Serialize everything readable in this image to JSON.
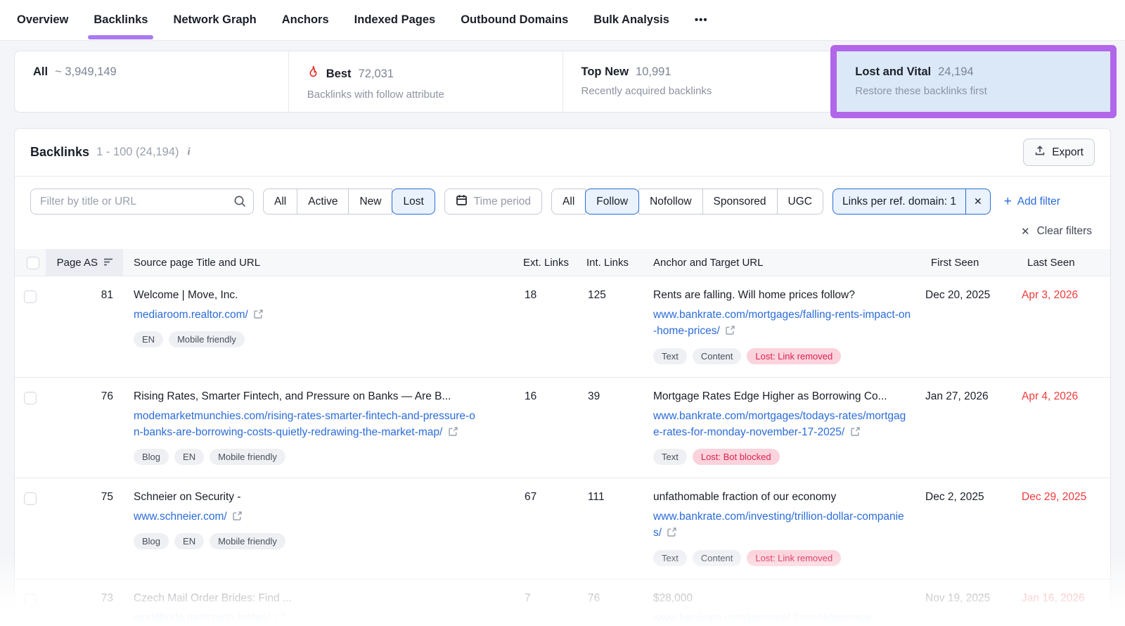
{
  "colors": {
    "accent_purple": "#a879f3",
    "annotation_purple": "#b266ea",
    "link_blue": "#2b6cd9",
    "selected_filter_bg": "#e9f2fd",
    "lost_red": "#dd2150",
    "last_seen_red": "#ef3a3a",
    "highlight_card_bg": "#dbe8f8"
  },
  "nav": {
    "tabs": [
      "Overview",
      "Backlinks",
      "Network Graph",
      "Anchors",
      "Indexed Pages",
      "Outbound Domains",
      "Bulk Analysis"
    ],
    "active_tab": "Backlinks",
    "more_label": "•••"
  },
  "summary_cards": [
    {
      "title": "All",
      "value": "~ 3,949,149",
      "subtitle": ""
    },
    {
      "title": "Best",
      "value": "72,031",
      "subtitle": "Backlinks with follow attribute",
      "icon": "flame-icon"
    },
    {
      "title": "Top New",
      "value": "10,991",
      "subtitle": "Recently acquired backlinks"
    },
    {
      "title": "Lost and Vital",
      "value": "24,194",
      "subtitle": "Restore these backlinks first",
      "highlighted": true
    }
  ],
  "panel": {
    "title": "Backlinks",
    "range": "1 - 100 (24,194)",
    "export_label": "Export",
    "filters": {
      "search_placeholder": "Filter by title or URL",
      "status_options": [
        "All",
        "Active",
        "New",
        "Lost"
      ],
      "status_selected": "Lost",
      "time_period_label": "Time period",
      "follow_options": [
        "All",
        "Follow",
        "Nofollow",
        "Sponsored",
        "UGC"
      ],
      "follow_selected": "Follow",
      "chip_label": "Links per ref. domain: 1",
      "chip_remove": "✕",
      "add_filter_plus": "+",
      "add_filter_label": "Add filter",
      "clear_x": "✕",
      "clear_filters_label": "Clear filters"
    },
    "table": {
      "columns": {
        "page_as": "Page AS",
        "source": "Source page Title and URL",
        "ext": "Ext. Links",
        "int": "Int. Links",
        "anchor": "Anchor and Target URL",
        "first_seen": "First Seen",
        "last_seen": "Last Seen"
      },
      "rows": [
        {
          "page_as": "81",
          "title": "Welcome | Move, Inc.",
          "url": "mediaroom.realtor.com/",
          "source_badges": [
            "EN",
            "Mobile friendly"
          ],
          "ext_links": "18",
          "int_links": "125",
          "anchor": "Rents are falling. Will home prices follow?",
          "target_url": "www.bankrate.com/mortgages/falling-rents-impact-on-home-prices/",
          "anchor_badges": [
            "Text",
            "Content"
          ],
          "lost_badge": "Lost: Link removed",
          "first_seen": "Dec 20, 2025",
          "last_seen": "Apr 3, 2026"
        },
        {
          "page_as": "76",
          "title": "Rising Rates, Smarter Fintech, and Pressure on Banks — Are B...",
          "url": "modemarketmunchies.com/rising-rates-smarter-fintech-and-pressure-on-banks-are-borrowing-costs-quietly-redrawing-the-market-map/",
          "source_badges": [
            "Blog",
            "EN",
            "Mobile friendly"
          ],
          "ext_links": "16",
          "int_links": "39",
          "anchor": "Mortgage Rates Edge Higher as Borrowing Co...",
          "target_url": "www.bankrate.com/mortgages/todays-rates/mortgage-rates-for-monday-november-17-2025/",
          "anchor_badges": [
            "Text"
          ],
          "lost_badge": "Lost: Bot blocked",
          "first_seen": "Jan 27, 2026",
          "last_seen": "Apr 4, 2026"
        },
        {
          "page_as": "75",
          "title": "Schneier on Security -",
          "url": "www.schneier.com/",
          "source_badges": [
            "Blog",
            "EN",
            "Mobile friendly"
          ],
          "ext_links": "67",
          "int_links": "111",
          "anchor": "unfathomable fraction of our economy",
          "target_url": "www.bankrate.com/investing/trillion-dollar-companies/",
          "anchor_badges": [
            "Text",
            "Content"
          ],
          "lost_badge": "Lost: Link removed",
          "first_seen": "Dec 2, 2025",
          "last_seen": "Dec 29, 2025"
        },
        {
          "page_as": "73",
          "title": "Czech Mail Order Brides: Find ...",
          "url": "worldbride.net/czech-brides/",
          "source_badges": [],
          "ext_links": "7",
          "int_links": "76",
          "anchor": "$28,000",
          "target_url": "www.bankrate.com/personal-finance/average-",
          "anchor_badges": [],
          "lost_badge": "",
          "first_seen": "Nov 19, 2025",
          "last_seen": "Jan 16, 2026"
        }
      ]
    }
  }
}
